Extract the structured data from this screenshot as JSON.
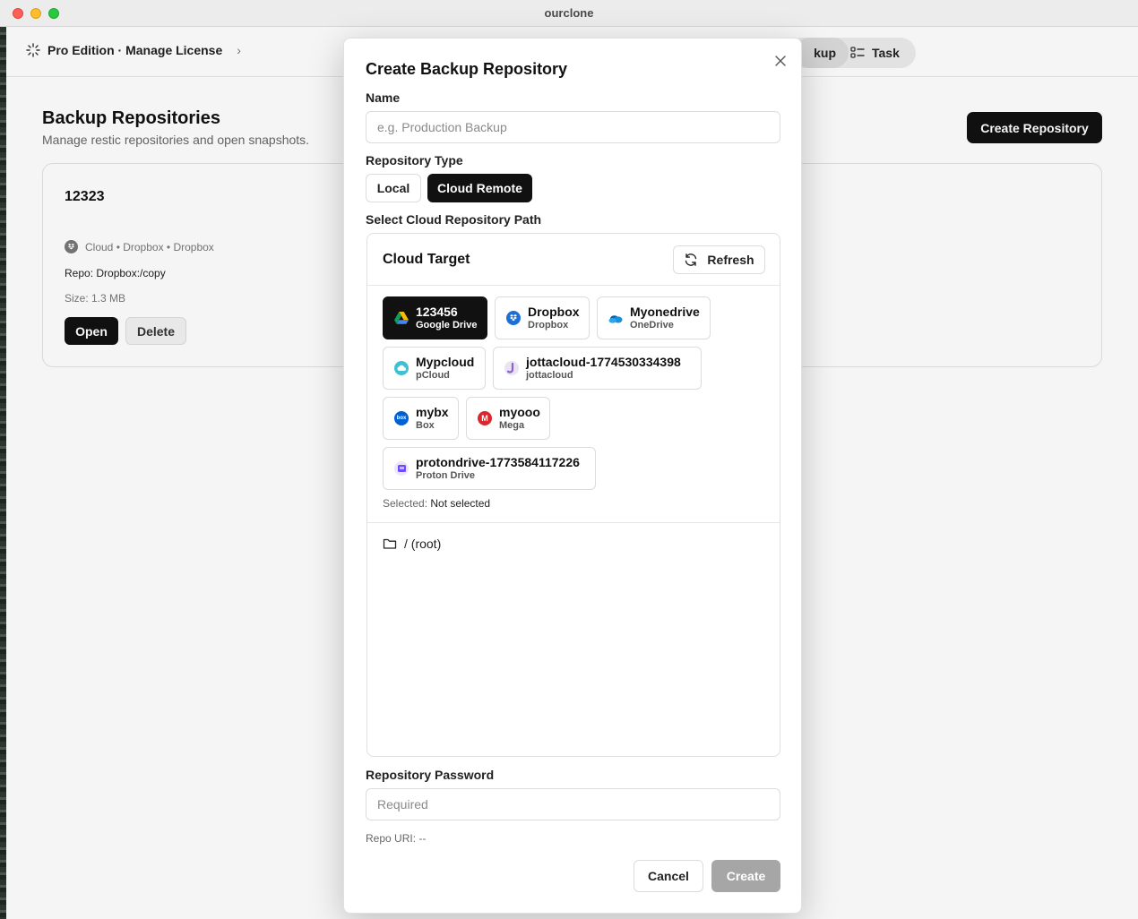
{
  "window": {
    "title": "ourclone"
  },
  "topbar": {
    "license_label": "Pro Edition · Manage License",
    "nav": {
      "backup_partial": "kup",
      "task": "Task"
    }
  },
  "page": {
    "title": "Backup Repositories",
    "subtitle": "Manage restic repositories and open snapshots.",
    "create_button": "Create Repository"
  },
  "repo_card": {
    "name": "12323",
    "meta": "Cloud • Dropbox • Dropbox",
    "repo": "Repo: Dropbox:/copy",
    "size": "Size: 1.3 MB",
    "open": "Open",
    "delete": "Delete"
  },
  "modal": {
    "title": "Create Backup Repository",
    "name_label": "Name",
    "name_placeholder": "e.g. Production Backup",
    "type_label": "Repository Type",
    "type_local": "Local",
    "type_cloud": "Cloud Remote",
    "path_label": "Select Cloud Repository Path",
    "cloud_target_title": "Cloud Target",
    "refresh": "Refresh",
    "remotes": [
      {
        "name": "123456",
        "type": "Google Drive",
        "icon": "google-drive-icon",
        "active": true
      },
      {
        "name": "Dropbox",
        "type": "Dropbox",
        "icon": "dropbox-icon"
      },
      {
        "name": "Myonedrive",
        "type": "OneDrive",
        "icon": "onedrive-icon"
      },
      {
        "name": "Mypcloud",
        "type": "pCloud",
        "icon": "pcloud-icon"
      },
      {
        "name": "jottacloud-1774530334398",
        "type": "jottacloud",
        "icon": "jottacloud-icon"
      },
      {
        "name": "mybx",
        "type": "Box",
        "icon": "box-icon"
      },
      {
        "name": "myooo",
        "type": "Mega",
        "icon": "mega-icon"
      },
      {
        "name": "protondrive-1773584117226",
        "type": "Proton Drive",
        "icon": "proton-drive-icon"
      }
    ],
    "selected_label": "Selected:",
    "selected_value": "Not selected",
    "root_path": "/ (root)",
    "password_label": "Repository Password",
    "password_placeholder": "Required",
    "repo_uri": "Repo URI: --",
    "cancel": "Cancel",
    "create": "Create"
  },
  "colors": {
    "primary": "#111111",
    "disabled": "#a6a6a6",
    "border": "#dcdcdc"
  }
}
